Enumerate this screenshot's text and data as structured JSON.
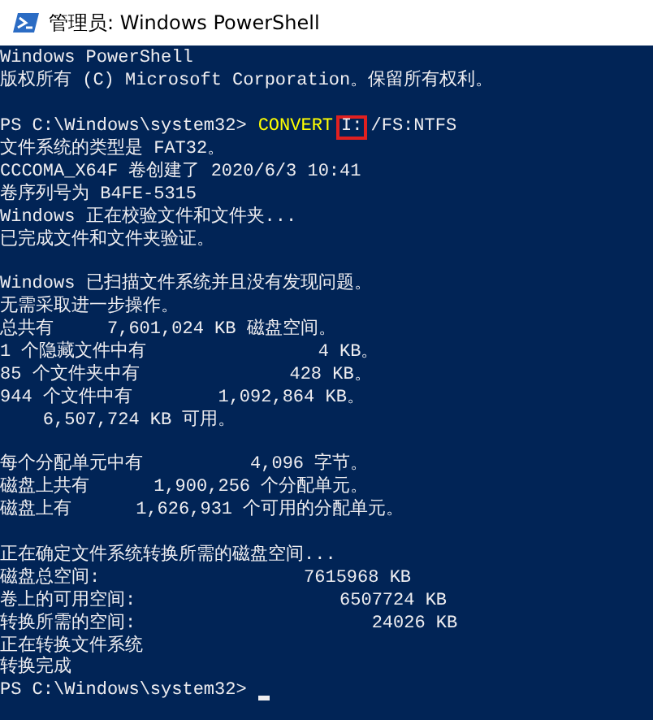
{
  "window": {
    "title": "管理员: Windows PowerShell"
  },
  "console": {
    "lines": [
      {
        "kind": "output",
        "text": "Windows PowerShell"
      },
      {
        "kind": "output",
        "text": "版权所有 (C) Microsoft Corporation。保留所有权利。"
      },
      {
        "kind": "blank"
      },
      {
        "kind": "command",
        "prompt": "PS C:\\Windows\\system32>",
        "command": "CONVERT",
        "argument": "I:",
        "highlighted": true,
        "rest": "/FS:NTFS"
      },
      {
        "kind": "output",
        "text": "文件系统的类型是 FAT32。"
      },
      {
        "kind": "output",
        "text": "CCCOMA_X64F 卷创建了 2020/6/3 10:41"
      },
      {
        "kind": "output",
        "text": "卷序列号为 B4FE-5315"
      },
      {
        "kind": "output",
        "text": "Windows 正在校验文件和文件夹..."
      },
      {
        "kind": "output",
        "text": "已完成文件和文件夹验证。"
      },
      {
        "kind": "blank"
      },
      {
        "kind": "output",
        "text": "Windows 已扫描文件系统并且没有发现问题。"
      },
      {
        "kind": "output",
        "text": "无需采取进一步操作。"
      },
      {
        "kind": "output",
        "text": "总共有     7,601,024 KB 磁盘空间。"
      },
      {
        "kind": "output",
        "text": "1 个隐藏文件中有                4 KB。"
      },
      {
        "kind": "output",
        "text": "85 个文件夹中有              428 KB。"
      },
      {
        "kind": "output",
        "text": "944 个文件中有        1,092,864 KB。"
      },
      {
        "kind": "output",
        "text": "    6,507,724 KB 可用。"
      },
      {
        "kind": "blank"
      },
      {
        "kind": "output",
        "text": "每个分配单元中有          4,096 字节。"
      },
      {
        "kind": "output",
        "text": "磁盘上共有      1,900,256 个分配单元。"
      },
      {
        "kind": "output",
        "text": "磁盘上有      1,626,931 个可用的分配单元。"
      },
      {
        "kind": "blank"
      },
      {
        "kind": "output",
        "text": "正在确定文件系统转换所需的磁盘空间..."
      },
      {
        "kind": "output",
        "text": "磁盘总空间:                   7615968 KB"
      },
      {
        "kind": "output",
        "text": "卷上的可用空间:                   6507724 KB"
      },
      {
        "kind": "output",
        "text": "转换所需的空间:                      24026 KB"
      },
      {
        "kind": "output",
        "text": "正在转换文件系统"
      },
      {
        "kind": "output",
        "text": "转换完成"
      },
      {
        "kind": "prompt",
        "prompt": "PS C:\\Windows\\system32>"
      }
    ]
  }
}
